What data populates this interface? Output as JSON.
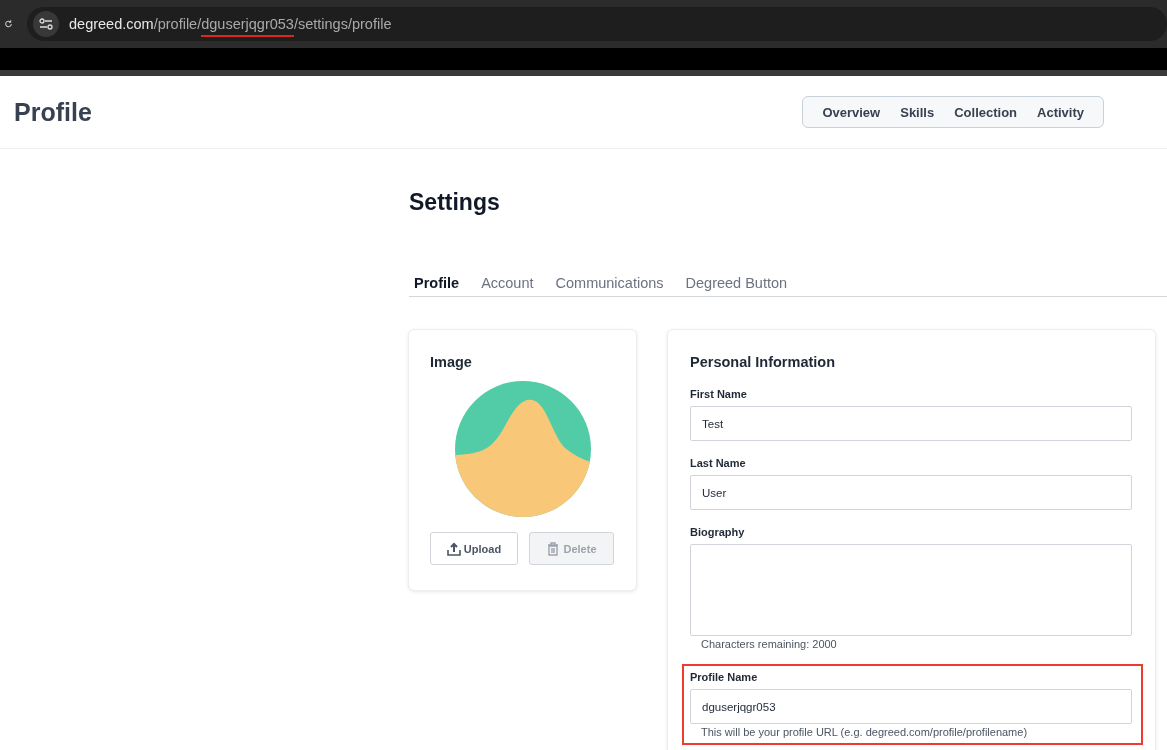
{
  "address_bar": {
    "host": "degreed.com",
    "path_parts": [
      {
        "text": "/profile/",
        "highlighted": false
      },
      {
        "text": "dguserjqgr053",
        "highlighted": true
      },
      {
        "text": "/settings/profile",
        "highlighted": false
      }
    ]
  },
  "header": {
    "title": "Profile",
    "nav": [
      {
        "label": "Overview",
        "selected": false
      },
      {
        "label": "Skills",
        "selected": false
      },
      {
        "label": "Collection",
        "selected": false
      },
      {
        "label": "Activity",
        "selected": false
      }
    ]
  },
  "settings": {
    "title": "Settings",
    "tabs": [
      {
        "label": "Profile",
        "selected": true
      },
      {
        "label": "Account",
        "selected": false
      },
      {
        "label": "Communications",
        "selected": false
      },
      {
        "label": "Degreed Button",
        "selected": false
      }
    ]
  },
  "image_card": {
    "title": "Image",
    "buttons": [
      {
        "label": "Upload",
        "kind": "upload",
        "disabled": false
      },
      {
        "label": "Delete",
        "kind": "delete",
        "disabled": true
      }
    ]
  },
  "personal_info": {
    "title": "Personal Information",
    "fields": [
      {
        "label": "First Name",
        "kind": "input",
        "value": "Test",
        "highlighted": false
      },
      {
        "label": "Last Name",
        "kind": "input",
        "value": "User",
        "highlighted": false
      },
      {
        "label": "Biography",
        "kind": "textarea",
        "hint": "Characters remaining: 2000",
        "highlighted": false
      },
      {
        "label": "Profile Name",
        "kind": "input",
        "value": "dguserjqgr053",
        "hint": "This will be your profile URL (e.g. degreed.com/profile/profilename)",
        "highlighted": true
      }
    ]
  }
}
